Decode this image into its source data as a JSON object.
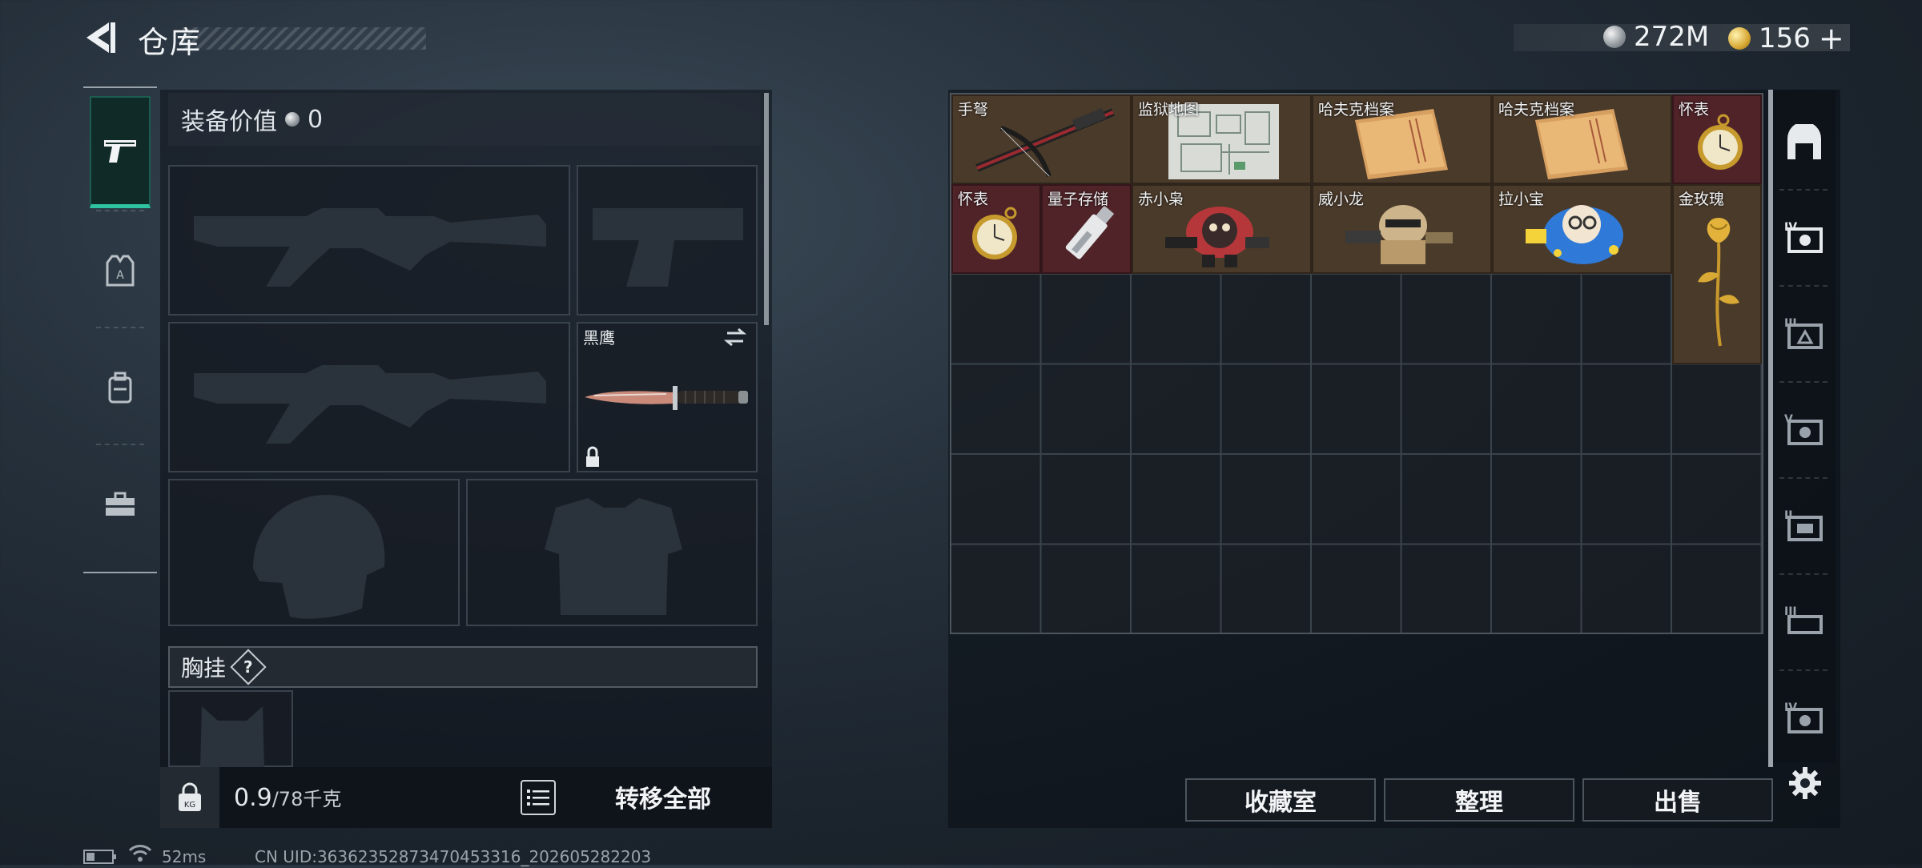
{
  "header": {
    "title": "仓库",
    "currency_silver": "272M",
    "currency_gold": "156",
    "add_gold": "+"
  },
  "tabs": [
    "weapons",
    "equipment",
    "backpack",
    "toolbox"
  ],
  "equipment": {
    "value_label": "装备价值",
    "value_amount": "0",
    "melee_name": "黑鹰",
    "chest_rig_label": "胸挂",
    "help": "?"
  },
  "footer_left": {
    "weight_current": "0.9",
    "weight_max": "/78千克",
    "transfer_all": "转移全部"
  },
  "storage": {
    "items": [
      {
        "name": "手弩",
        "bg": "brown"
      },
      {
        "name": "监狱地图",
        "bg": "brown"
      },
      {
        "name": "哈夫克档案",
        "bg": "brown"
      },
      {
        "name": "哈夫克档案",
        "bg": "brown"
      },
      {
        "name": "怀表",
        "bg": "red"
      },
      {
        "name": "怀表",
        "bg": "red"
      },
      {
        "name": "量子存储",
        "bg": "red"
      },
      {
        "name": "赤小枭",
        "bg": "brown"
      },
      {
        "name": "威小龙",
        "bg": "brown"
      },
      {
        "name": "拉小宝",
        "bg": "brown"
      },
      {
        "name": "金玫瑰",
        "bg": "brown"
      }
    ],
    "buttons": {
      "collection": "收藏室",
      "organize": "整理",
      "sell": "出售"
    }
  },
  "status_bar": {
    "ping": "52ms",
    "uid": "CN UID:36362352873470453316_202605282203"
  },
  "colors": {
    "accent": "#2ec4a2",
    "item_brown": "#4a3a2a",
    "item_red": "#4f2328"
  }
}
